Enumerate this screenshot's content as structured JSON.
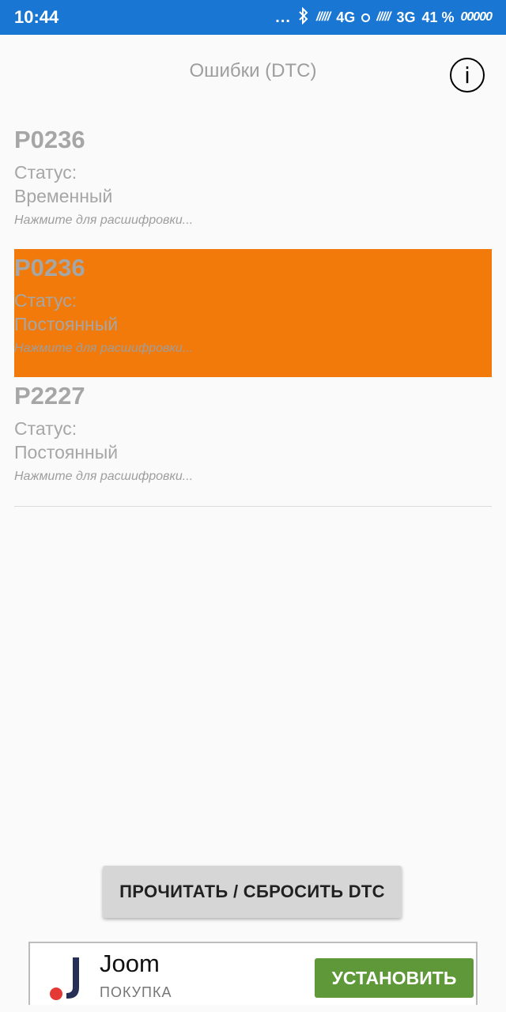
{
  "status_bar": {
    "time": "10:44",
    "dots": "...",
    "network1": "4G",
    "network2": "3G",
    "battery_text": "41 %"
  },
  "header": {
    "title": "Ошибки (DTC)",
    "info_icon": "i"
  },
  "dtc_items": [
    {
      "code": "P0236",
      "status_label": "Статус:",
      "status_value": "Временный",
      "hint": "Нажмите для расшифровки...",
      "selected": false
    },
    {
      "code": "P0236",
      "status_label": "Статус:",
      "status_value": "Постоянный",
      "hint": "Нажмите для расшифровки...",
      "selected": true
    },
    {
      "code": "P2227",
      "status_label": "Статус:",
      "status_value": "Постоянный",
      "hint": "Нажмите для расшифровки...",
      "selected": false
    }
  ],
  "actions": {
    "read_reset_label": "ПРОЧИТАТЬ / СБРОСИТЬ DTC"
  },
  "ad": {
    "name": "Joom",
    "subtitle": "ПОКУПКА",
    "install_label": "УСТАНОВИТЬ"
  },
  "colors": {
    "status_bar": "#1976d2",
    "selected_row": "#f27a0a",
    "install_button": "#5e9838"
  }
}
